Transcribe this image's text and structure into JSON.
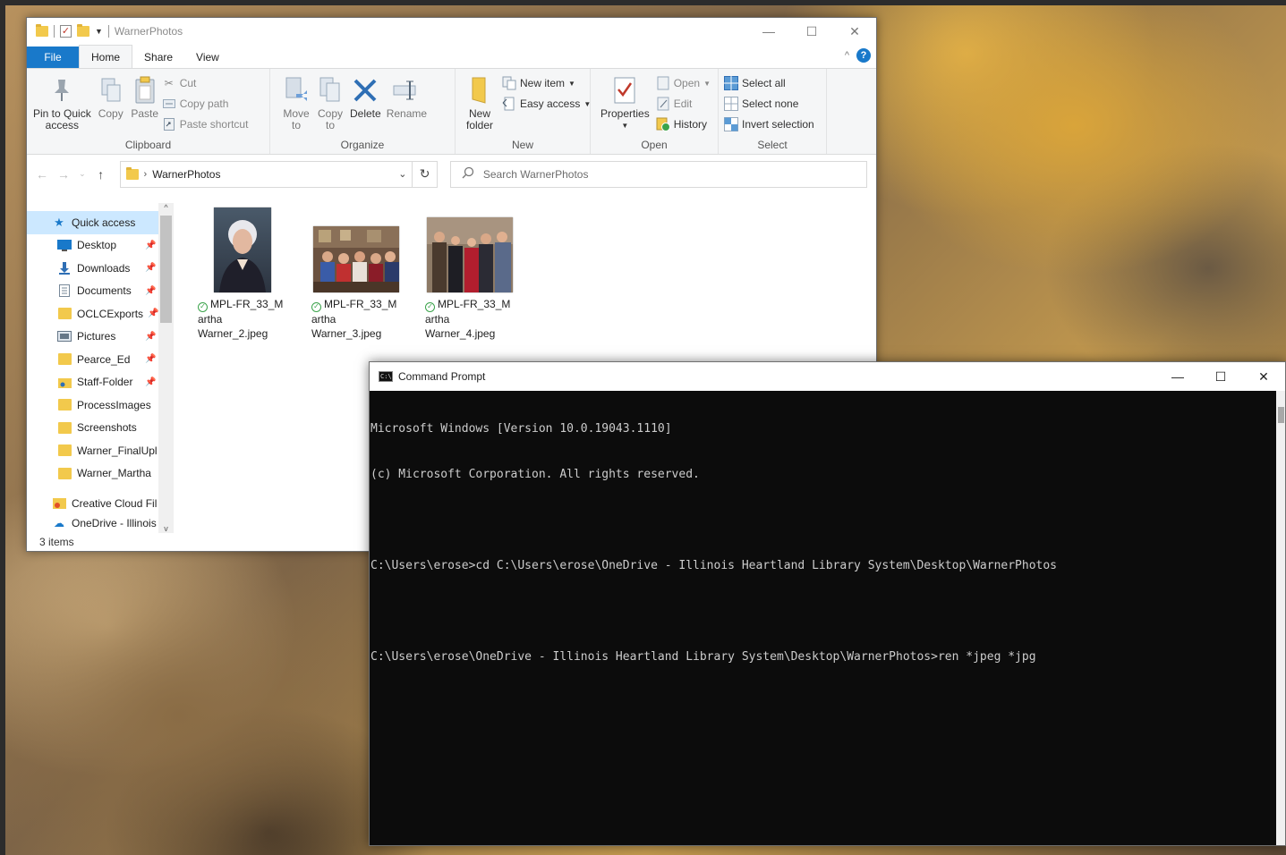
{
  "explorer": {
    "title": "WarnerPhotos",
    "tabs": [
      {
        "label": "File"
      },
      {
        "label": "Home"
      },
      {
        "label": "Share"
      },
      {
        "label": "View"
      }
    ],
    "ribbon": {
      "clipboard": {
        "label": "Clipboard",
        "pin_line1": "Pin to Quick",
        "pin_line2": "access",
        "copy": "Copy",
        "paste": "Paste",
        "cut": "Cut",
        "copy_path": "Copy path",
        "paste_shortcut": "Paste shortcut"
      },
      "organize": {
        "label": "Organize",
        "move_line1": "Move",
        "move_line2": "to",
        "copy_line1": "Copy",
        "copy_line2": "to",
        "delete": "Delete",
        "rename": "Rename"
      },
      "new": {
        "label": "New",
        "new_folder_line1": "New",
        "new_folder_line2": "folder",
        "new_item": "New item",
        "easy_access": "Easy access"
      },
      "open": {
        "label": "Open",
        "properties": "Properties",
        "open": "Open",
        "edit": "Edit",
        "history": "History"
      },
      "select": {
        "label": "Select",
        "select_all": "Select all",
        "select_none": "Select none",
        "invert_selection": "Invert selection"
      }
    },
    "address": {
      "path": "WarnerPhotos",
      "search_placeholder": "Search WarnerPhotos"
    },
    "nav": [
      {
        "label": "Quick access"
      },
      {
        "label": "Desktop"
      },
      {
        "label": "Downloads"
      },
      {
        "label": "Documents"
      },
      {
        "label": "OCLCExports"
      },
      {
        "label": "Pictures"
      },
      {
        "label": "Pearce_Ed"
      },
      {
        "label": "Staff-Folder"
      },
      {
        "label": "ProcessImages"
      },
      {
        "label": "Screenshots"
      },
      {
        "label": "Warner_FinalUpl"
      },
      {
        "label": "Warner_Martha"
      },
      {
        "label": "Creative Cloud Fil"
      },
      {
        "label": "OneDrive - Illinois"
      }
    ],
    "files": [
      {
        "l1": "MPL-FR_33_M",
        "l2": "artha",
        "l3": "Warner_2.jpeg"
      },
      {
        "l1": "MPL-FR_33_M",
        "l2": "artha",
        "l3": "Warner_3.jpeg"
      },
      {
        "l1": "MPL-FR_33_M",
        "l2": "artha",
        "l3": "Warner_4.jpeg"
      }
    ],
    "status": "3 items"
  },
  "cmd": {
    "title": "Command Prompt",
    "lines": [
      "Microsoft Windows [Version 10.0.19043.1110]",
      "(c) Microsoft Corporation. All rights reserved.",
      "",
      "C:\\Users\\erose>cd C:\\Users\\erose\\OneDrive - Illinois Heartland Library System\\Desktop\\WarnerPhotos",
      "",
      "C:\\Users\\erose\\OneDrive - Illinois Heartland Library System\\Desktop\\WarnerPhotos>ren *jpeg *jpg"
    ]
  }
}
